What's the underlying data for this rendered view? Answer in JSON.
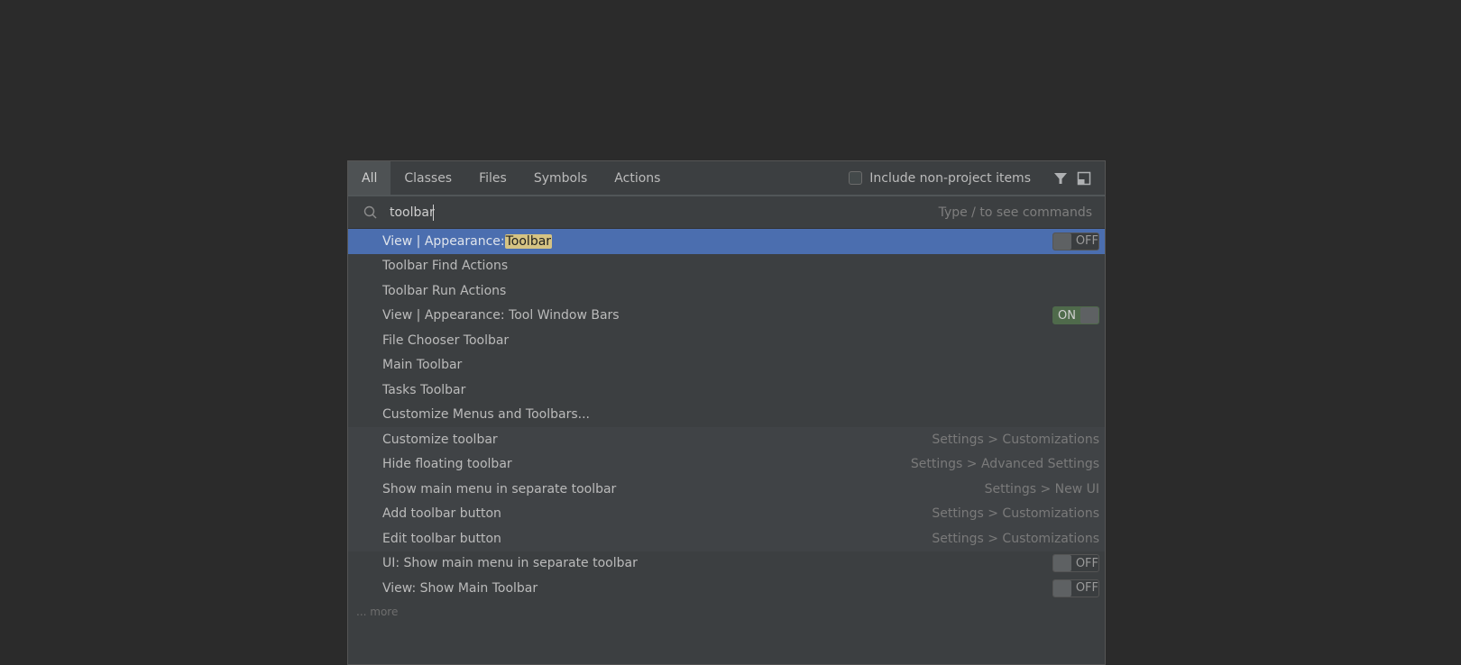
{
  "tabs": [
    {
      "label": "All",
      "active": true
    },
    {
      "label": "Classes",
      "active": false
    },
    {
      "label": "Files",
      "active": false
    },
    {
      "label": "Symbols",
      "active": false
    },
    {
      "label": "Actions",
      "active": false
    }
  ],
  "include_non_project": {
    "label": "Include non-project items",
    "checked": false
  },
  "icons": {
    "filter": "filter-icon",
    "preview": "preview-panel-icon",
    "search": "search-icon"
  },
  "search": {
    "value": "toolbar",
    "hint": "Type / to see commands"
  },
  "colors": {
    "selection": "#4b6eaf",
    "highlight": "#d5c383",
    "toggle_on": "#4f6a4b"
  },
  "results": [
    {
      "prefix": "View | Appearance: ",
      "match": "Toolbar",
      "toggle": "OFF",
      "selected": true
    },
    {
      "label": "Toolbar Find Actions"
    },
    {
      "label": "Toolbar Run Actions"
    },
    {
      "label": "View | Appearance: Tool Window Bars",
      "toggle": "ON"
    },
    {
      "label": "File Chooser Toolbar"
    },
    {
      "label": "Main Toolbar"
    },
    {
      "label": "Tasks Toolbar"
    },
    {
      "label": "Customize Menus and Toolbars..."
    },
    {
      "label": "Customize toolbar",
      "location": "Settings > Customizations"
    },
    {
      "label": "Hide floating toolbar",
      "location": "Settings > Advanced Settings"
    },
    {
      "label": "Show main menu in separate toolbar",
      "location": "Settings > New UI"
    },
    {
      "label": "Add toolbar button",
      "location": "Settings > Customizations"
    },
    {
      "label": "Edit toolbar button",
      "location": "Settings > Customizations"
    },
    {
      "label": "UI: Show main menu in separate toolbar",
      "toggle": "OFF"
    },
    {
      "label": "View: Show Main Toolbar",
      "toggle": "OFF"
    }
  ],
  "more_label": "... more"
}
